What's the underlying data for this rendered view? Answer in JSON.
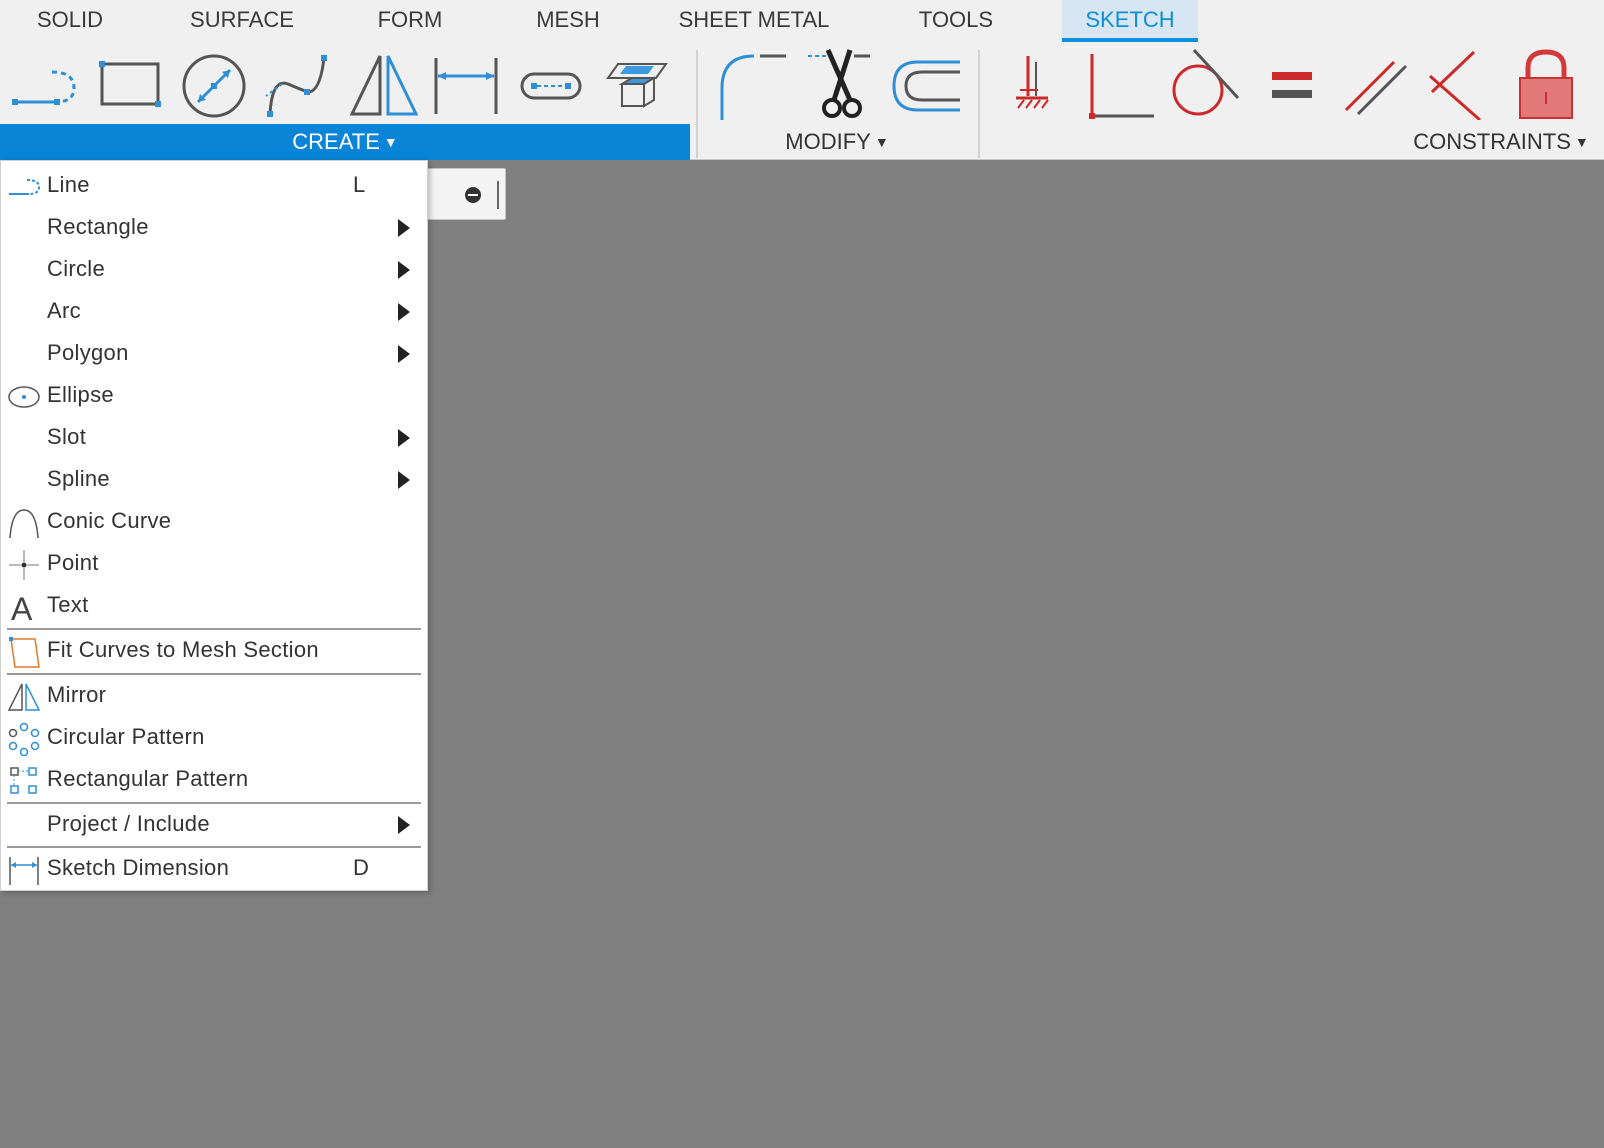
{
  "tabs": [
    {
      "label": "SOLID"
    },
    {
      "label": "SURFACE"
    },
    {
      "label": "FORM"
    },
    {
      "label": "MESH"
    },
    {
      "label": "SHEET METAL"
    },
    {
      "label": "TOOLS"
    },
    {
      "label": "SKETCH",
      "active": true
    }
  ],
  "groups": {
    "create": "CREATE",
    "modify": "MODIFY",
    "constraints": "CONSTRAINTS"
  },
  "ribbon_tools": {
    "create": [
      "line-tool-icon",
      "rectangle-tool-icon",
      "circle-tool-icon",
      "spline-tool-icon",
      "mirror-tool-icon",
      "dimension-tool-icon",
      "slot-tool-icon",
      "project-tool-icon"
    ],
    "modify": [
      "fillet-tool-icon",
      "trim-tool-icon",
      "offset-tool-icon"
    ],
    "constraints": [
      "fix-constraint-icon",
      "perpendicular-constraint-icon",
      "tangent-constraint-icon",
      "equal-constraint-icon",
      "parallel-constraint-icon",
      "coincident-constraint-icon",
      "lock-icon"
    ]
  },
  "colors": {
    "accent": "#0a84d6",
    "constraint_red": "#cc2a2a",
    "icon_blue": "#2f8fd6"
  },
  "menu": {
    "items": [
      {
        "label": "Line",
        "shortcut": "L",
        "icon": "line-icon"
      },
      {
        "label": "Rectangle",
        "submenu": true
      },
      {
        "label": "Circle",
        "submenu": true
      },
      {
        "label": "Arc",
        "submenu": true
      },
      {
        "label": "Polygon",
        "submenu": true
      },
      {
        "label": "Ellipse",
        "icon": "ellipse-icon"
      },
      {
        "label": "Slot",
        "submenu": true
      },
      {
        "label": "Spline",
        "submenu": true
      },
      {
        "label": "Conic Curve",
        "icon": "conic-curve-icon"
      },
      {
        "label": "Point",
        "icon": "point-icon"
      },
      {
        "label": "Text",
        "icon": "text-icon"
      },
      {
        "label": "Fit Curves to Mesh Section",
        "icon": "fit-curves-icon"
      },
      {
        "label": "Mirror",
        "icon": "mirror-icon"
      },
      {
        "label": "Circular Pattern",
        "icon": "circular-pattern-icon"
      },
      {
        "label": "Rectangular Pattern",
        "icon": "rectangular-pattern-icon"
      },
      {
        "label": "Project / Include",
        "submenu": true
      },
      {
        "label": "Sketch Dimension",
        "shortcut": "D",
        "icon": "sketch-dimension-icon"
      }
    ]
  }
}
